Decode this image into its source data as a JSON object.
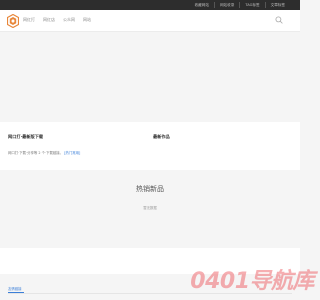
{
  "topbar": {
    "links": [
      "收藏网站",
      "网站收录",
      "TAG标签",
      "文章标签"
    ]
  },
  "header": {
    "nav": [
      "网红打",
      "网红店",
      "公众网",
      "网站"
    ]
  },
  "panel": {
    "left_title": "网口打·最新版下载",
    "left_desc_prefix": "网口打·下载·分享等 2 个·下载链接。",
    "left_desc_link": "[热门常用]",
    "right_title": "最新作品"
  },
  "hot": {
    "heading": "热销新品",
    "subtitle": "暂无数据"
  },
  "footer": {
    "tab_label": "友情链接"
  },
  "watermark": {
    "text": "0401导航库"
  },
  "colors": {
    "topbar": "#2d2d2d",
    "accent": "#3b7fd8",
    "logo": "#e8873a",
    "watermark": "#ef6c72"
  }
}
